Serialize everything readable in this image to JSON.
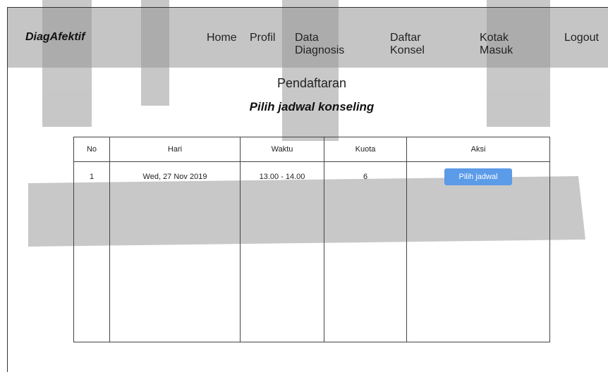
{
  "app": {
    "brand": "DiagAfektif"
  },
  "nav": {
    "items": [
      {
        "label": "Home"
      },
      {
        "label": "Profil"
      },
      {
        "label": "Data Diagnosis"
      },
      {
        "label": "Daftar Konsel"
      },
      {
        "label": "Kotak Masuk"
      },
      {
        "label": "Logout"
      }
    ]
  },
  "page": {
    "title": "Pendaftaran",
    "subtitle": "Pilih jadwal konseling"
  },
  "table": {
    "headers": [
      "No",
      "Hari",
      "Waktu",
      "Kuota",
      "Aksi"
    ],
    "rows": [
      {
        "no": "1",
        "hari": "Wed, 27 Nov 2019",
        "waktu": "13.00 - 14.00",
        "kuota": "6",
        "aksi_label": "Pilih jadwal"
      }
    ]
  },
  "colors": {
    "navbar": "#969696",
    "button": "#5b9be8",
    "watermark": "#8c8c8c"
  }
}
